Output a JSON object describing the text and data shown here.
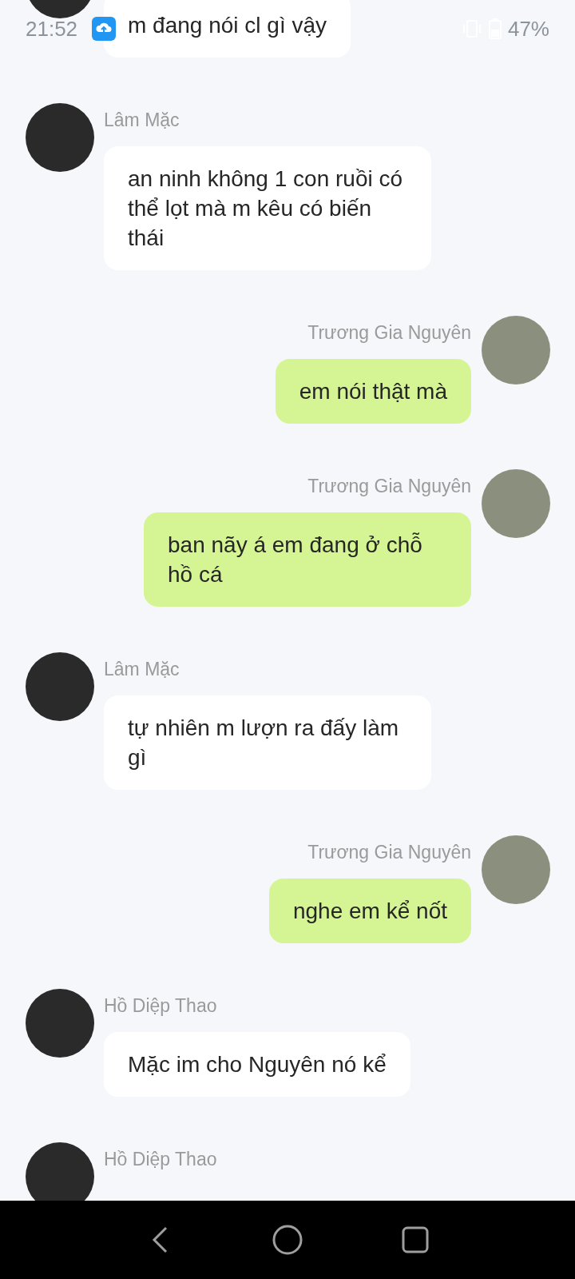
{
  "status_bar": {
    "time": "21:52",
    "battery": "47%"
  },
  "messages": [
    {
      "outgoing": false,
      "text": "m đang nói cl gì vậy"
    },
    {
      "outgoing": false,
      "sender": "Lâm Mặc",
      "text": "an ninh không 1 con ruồi có thể lọt mà m kêu có biến thái"
    },
    {
      "outgoing": true,
      "sender": "Trương Gia Nguyên",
      "text": "em nói thật mà"
    },
    {
      "outgoing": true,
      "sender": "Trương Gia Nguyên",
      "text": "ban nãy á em đang ở chỗ hồ cá"
    },
    {
      "outgoing": false,
      "sender": "Lâm Mặc",
      "text": "tự nhiên m lượn ra đấy làm gì"
    },
    {
      "outgoing": true,
      "sender": "Trương Gia Nguyên",
      "text": "nghe em kể nốt"
    },
    {
      "outgoing": false,
      "sender": "Hồ Diệp Thao",
      "text": "Mặc im cho Nguyên nó kể"
    },
    {
      "outgoing": false,
      "sender": "Hồ Diệp Thao"
    }
  ]
}
